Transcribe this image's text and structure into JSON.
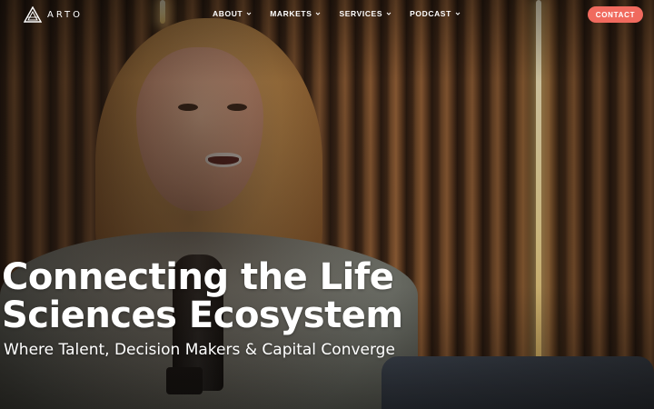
{
  "brand": {
    "name": "ARTO",
    "icon": "arto-logo-icon"
  },
  "nav": {
    "items": [
      {
        "label": "ABOUT",
        "icon": "chevron-down-icon"
      },
      {
        "label": "MARKETS",
        "icon": "chevron-down-icon"
      },
      {
        "label": "SERVICES",
        "icon": "chevron-down-icon"
      },
      {
        "label": "PODCAST",
        "icon": "chevron-down-icon"
      }
    ],
    "contact_label": "CONTACT"
  },
  "hero": {
    "headline_line1": "Connecting the Life",
    "headline_line2": "Sciences Ecosystem",
    "subheadline": "Where Talent, Decision Makers & Capital Converge"
  },
  "colors": {
    "accent": "#f06a5e",
    "text": "#ffffff"
  }
}
